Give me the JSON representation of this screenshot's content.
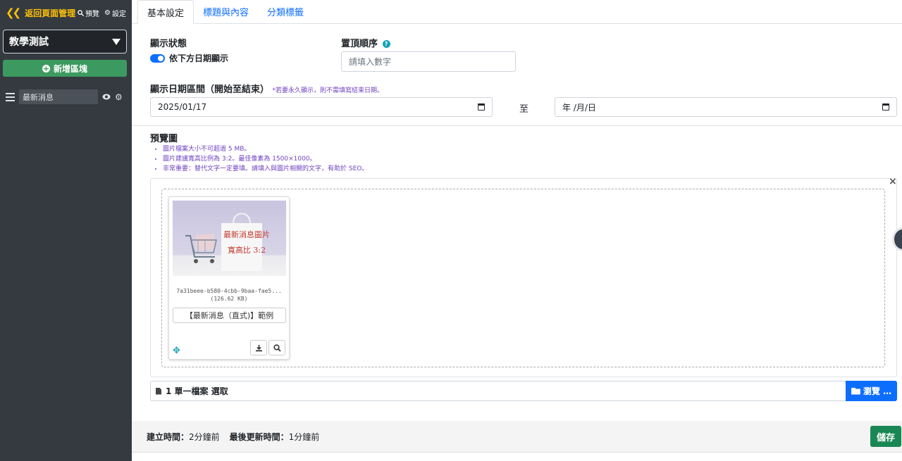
{
  "sidebar": {
    "back_label": "返回頁面管理",
    "preview_label": "預覽",
    "settings_label": "設定",
    "site_select": "教學測試",
    "add_block_label": "新增區塊",
    "items": [
      {
        "label": "最新消息"
      }
    ]
  },
  "tabs": [
    {
      "label": "基本設定",
      "active": true
    },
    {
      "label": "標題與內容",
      "active": false
    },
    {
      "label": "分類標籤",
      "active": false
    }
  ],
  "form": {
    "display_status_label": "顯示狀態",
    "display_toggle_label": "依下方日期顯示",
    "display_toggle_on": true,
    "pin_order_label": "置頂順序",
    "pin_order_placeholder": "請填入數字",
    "date_range_label": "顯示日期區間（開始至結束）",
    "date_range_note": "*若要永久顯示，則不需填寫結束日期。",
    "start_date": "2025/01/17",
    "to_label": "至",
    "end_date_placeholder": "年 /月/日",
    "preview_label": "預覽圖",
    "preview_notes": [
      "圖片檔案大小不可超過 5 MB。",
      "圖片建議寬高比例為 3:2。最佳像素為 1500×1000。",
      "非常重要：替代文字一定要填。請填入與圖片相關的文字，有助於 SEO。"
    ]
  },
  "uploader": {
    "close_label": "×",
    "thumbnail": {
      "image_text_line1": "最新消息圖片",
      "image_text_line2": "寬高比 3:2",
      "file_name": "7a31beee-b580-4cbb-9baa-fae5...",
      "file_size": "(126.62 KB)",
      "caption": "【最新消息（直式)】範例"
    },
    "file_summary": "1 單一檔案 選取",
    "browse_label": "瀏覽 …"
  },
  "footer": {
    "created_label": "建立時間：",
    "created_value": "2分鐘前",
    "updated_label": "最後更新時間：",
    "updated_value": "1分鐘前",
    "save_label": "儲存"
  },
  "colors": {
    "sidebar_bg": "#343a40",
    "accent_yellow": "#ffc107",
    "add_green": "#3c9a60",
    "primary": "#0d6efd",
    "note_purple": "#6f42c1",
    "save_green": "#198754"
  }
}
